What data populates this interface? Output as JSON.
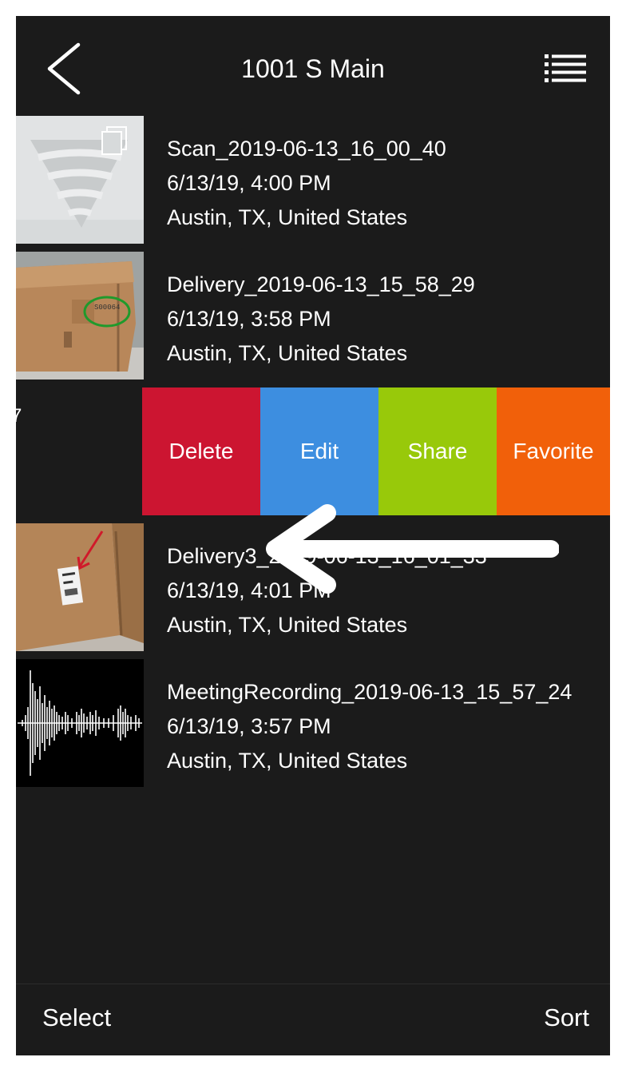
{
  "nav": {
    "title": "1001 S Main",
    "back_icon": "chevron-left-icon",
    "menu_icon": "list-icon"
  },
  "items": [
    {
      "name": "Scan_2019-06-13_16_00_40",
      "date": "6/13/19, 4:00 PM",
      "location": "Austin, TX, United States",
      "thumb": "scan"
    },
    {
      "name": "Delivery_2019-06-13_15_58_29",
      "date": "6/13/19, 3:58 PM",
      "location": "Austin, TX, United States",
      "thumb": "box-photo"
    },
    {
      "name": "Delivery3_2019-06-13_16_01_33",
      "date": "6/13/19, 4:01 PM",
      "location": "Austin, TX, United States",
      "thumb": "box-label-photo"
    },
    {
      "name": "MeetingRecording_2019-06-13_15_57_24",
      "date": "6/13/19, 3:57 PM",
      "location": "Austin, TX, United States",
      "thumb": "waveform"
    }
  ],
  "swiped_row": {
    "partial_text": "7"
  },
  "swipe_actions": [
    {
      "label": "Delete",
      "color": "#cc1531"
    },
    {
      "label": "Edit",
      "color": "#3d8ee0"
    },
    {
      "label": "Share",
      "color": "#98c90a"
    },
    {
      "label": "Favorite",
      "color": "#f1600a"
    }
  ],
  "toolbar": {
    "select_label": "Select",
    "sort_label": "Sort"
  },
  "colors": {
    "background": "#1b1b1b",
    "text": "#ffffff"
  }
}
